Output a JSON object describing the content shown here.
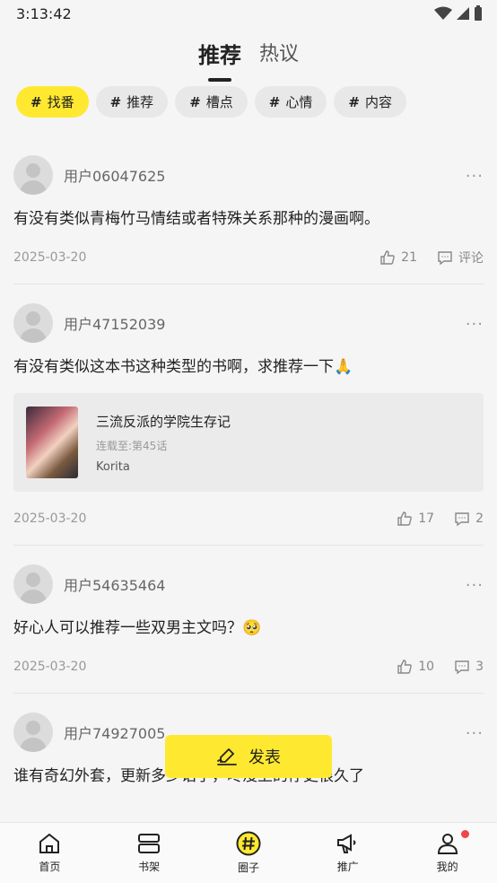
{
  "status_bar": {
    "time": "3:13:42"
  },
  "top_tabs": [
    {
      "label": "推荐",
      "active": true
    },
    {
      "label": "热议",
      "active": false
    }
  ],
  "chips": [
    {
      "label": "找番",
      "active": true
    },
    {
      "label": "推荐",
      "active": false
    },
    {
      "label": "槽点",
      "active": false
    },
    {
      "label": "心情",
      "active": false
    },
    {
      "label": "内容",
      "active": false
    }
  ],
  "chip_hash": "#",
  "more_glyph": "···",
  "posts": [
    {
      "username": "用户06047625",
      "text": "有没有类似青梅竹马情结或者特殊关系那种的漫画啊。",
      "date": "2025-03-20",
      "likes": "21",
      "comments": "评论"
    },
    {
      "username": "用户47152039",
      "text": "有没有类似这本书这种类型的书啊，求推荐一下🙏",
      "book": {
        "title": "三流反派的学院生存记",
        "status": "连载至:第45话",
        "author": "Korita"
      },
      "date": "2025-03-20",
      "likes": "17",
      "comments": "2"
    },
    {
      "username": "用户54635464",
      "text": "好心人可以推荐一些双男主文吗？🥺",
      "date": "2025-03-20",
      "likes": "10",
      "comments": "3"
    },
    {
      "username": "用户74927005",
      "text": "谁有奇幻外套，更新多少话了，咚漫上的停更很久了"
    }
  ],
  "publish_button": {
    "label": "发表"
  },
  "bottom_nav": [
    {
      "label": "首页",
      "icon": "home-icon"
    },
    {
      "label": "书架",
      "icon": "bookshelf-icon"
    },
    {
      "label": "圈子",
      "icon": "circle-hash-icon"
    },
    {
      "label": "推广",
      "icon": "megaphone-icon"
    },
    {
      "label": "我的",
      "icon": "profile-icon"
    }
  ],
  "colors": {
    "accent": "#ffe930",
    "badge": "#f04646"
  }
}
